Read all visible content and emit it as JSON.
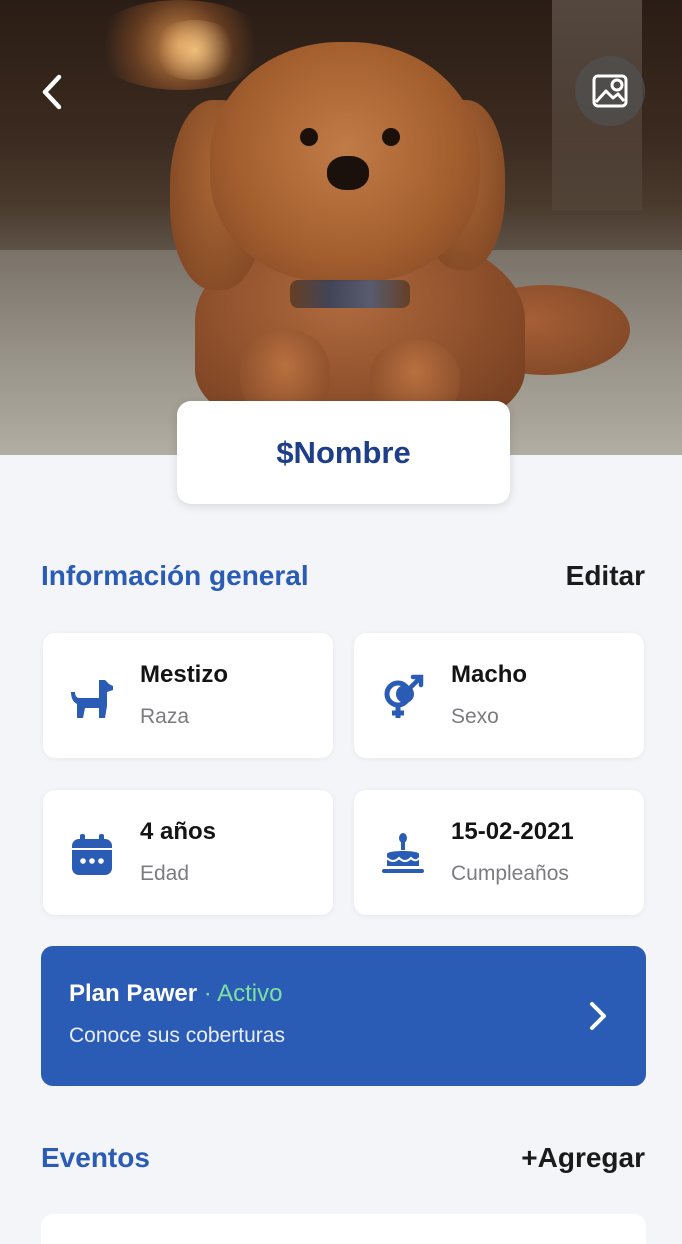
{
  "header": {
    "back_icon": "chevron-left-icon",
    "photo_icon": "image-pin-icon"
  },
  "pet": {
    "name": "$Nombre"
  },
  "general_info": {
    "title": "Información general",
    "action": "Editar",
    "cards": [
      {
        "value": "Mestizo",
        "label": "Raza",
        "icon": "dog-icon"
      },
      {
        "value": "Macho",
        "label": "Sexo",
        "icon": "gender-icon"
      },
      {
        "value": "4 años",
        "label": "Edad",
        "icon": "calendar-icon"
      },
      {
        "value": "15-02-2021",
        "label": "Cumpleaños",
        "icon": "cake-icon"
      }
    ]
  },
  "plan": {
    "name": "Plan Pawer",
    "separator": " · ",
    "status": "Activo",
    "subtitle": "Conoce sus coberturas",
    "status_color": "#7ee0a0",
    "background_color": "#2a5bb5"
  },
  "events": {
    "title": "Eventos",
    "action": "+Agregar"
  },
  "colors": {
    "accent": "#2a5bb5",
    "title_dark": "#1f3e8a",
    "background": "#f3f5f9"
  }
}
